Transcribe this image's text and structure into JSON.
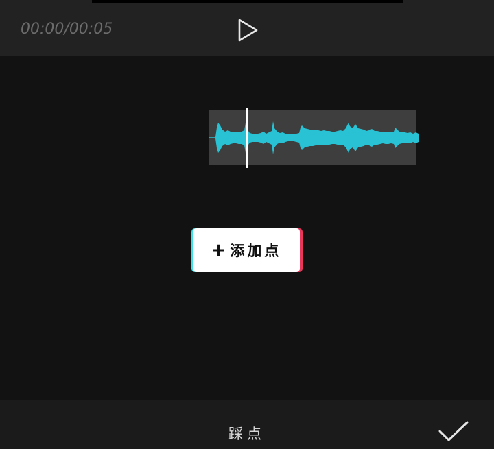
{
  "player": {
    "time": "00:00/00:05",
    "play_icon": "play-icon"
  },
  "audio_clip": {
    "wave_color": "#29c2d4",
    "background": "#3e3e3e",
    "playhead_color": "#ffffff"
  },
  "add_point": {
    "plus": "+",
    "label": "添加点"
  },
  "bottom": {
    "title": "踩点",
    "confirm_icon": "checkmark-icon"
  }
}
